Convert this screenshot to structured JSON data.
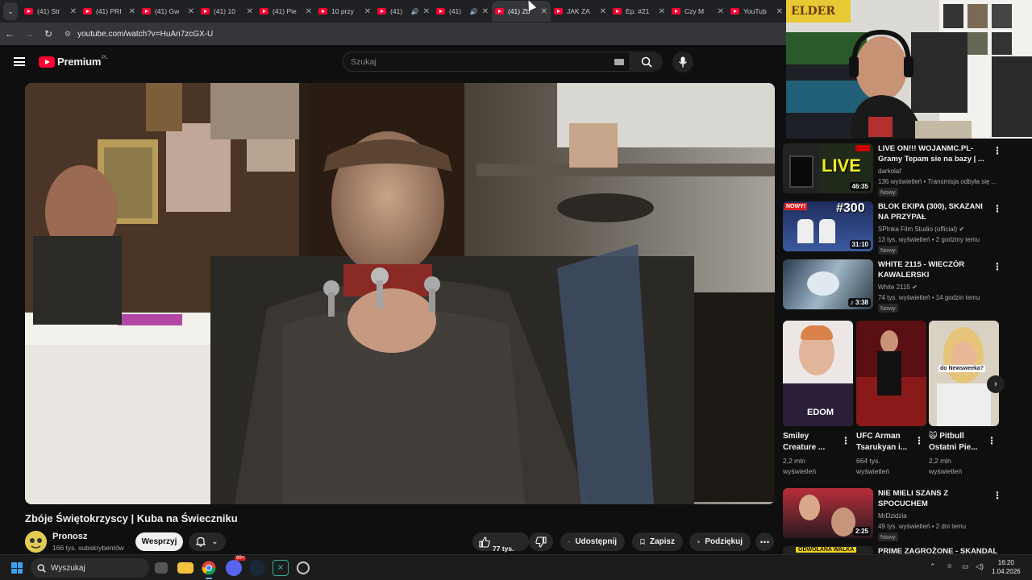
{
  "browser": {
    "tabs": [
      {
        "title": "(41) Str",
        "active": false,
        "audio": false
      },
      {
        "title": "(41) PRI",
        "active": false,
        "audio": false
      },
      {
        "title": "(41) Gw",
        "active": false,
        "audio": false
      },
      {
        "title": "(41) 10",
        "active": false,
        "audio": false
      },
      {
        "title": "(41) Pie",
        "active": false,
        "audio": false
      },
      {
        "title": "10 przy",
        "active": false,
        "audio": false
      },
      {
        "title": "(41)",
        "active": false,
        "audio": true
      },
      {
        "title": "(41)",
        "active": false,
        "audio": true
      },
      {
        "title": "(41) Zb",
        "active": true,
        "audio": false
      },
      {
        "title": "JAK ZA",
        "active": false,
        "audio": false
      },
      {
        "title": "Ep. #21",
        "active": false,
        "audio": false
      },
      {
        "title": "Czy M",
        "active": false,
        "audio": false
      },
      {
        "title": "YouTub",
        "active": false,
        "audio": false
      }
    ],
    "url": "youtube.com/watch?v=HuAn7zcGX-U"
  },
  "header": {
    "logo_text": "Premium",
    "country_code": "PL",
    "search_placeholder": "Szukaj"
  },
  "video": {
    "title": "Zbóje Świętokrzyscy | Kuba na Świeczniku",
    "channel_name": "Pronosz",
    "subscribers": "166 tys. subskrybentów",
    "support_label": "Wesprzyj",
    "like_count": "77 tys.",
    "share_label": "Udostępnij",
    "save_label": "Zapisz",
    "thanks_label": "Podziękuj"
  },
  "webcam": {
    "sign_text": "ELDER"
  },
  "sidebar": {
    "videos": [
      {
        "title": "LIVE ON!!! WOJANMC.PL- Gramy Tepam sie na bazy | ...",
        "channel": "darkolaf",
        "meta": "136 wyświetleń • Transmisja odbyła się ...",
        "duration": "46:35",
        "badge": "Nowy",
        "thumb_text": "LIVE"
      },
      {
        "title": "BLOK EKIPA (300), SKAZANI NA PRZYPAŁ",
        "channel": "SPInka Film Studio (official)",
        "meta": "13 tys. wyświetleń • 2 godziny temu",
        "duration": "31:10",
        "badge": "Nowy",
        "thumb_text": "#300",
        "thumb_tag": "NOWY!"
      },
      {
        "title": "WHITE 2115 - WIECZÓR KAWALERSKI",
        "channel": "White 2115",
        "meta": "74 tys. wyświetleń • 14 godzin temu",
        "duration": "♪ 3:38",
        "badge": "Nowy"
      }
    ],
    "shorts": [
      {
        "title": "Smiley Creature ...",
        "views": "2,2 mln",
        "views_unit": "wyświetleń",
        "overlay": "EDOM"
      },
      {
        "title": "UFC Arman Tsarukyan i...",
        "views": "664 tys.",
        "views_unit": "wyświetleń"
      },
      {
        "title": "🙀 Pitbull Ostatni Pie...",
        "views": "2,2 mln",
        "views_unit": "wyświetleń",
        "overlay": "do Newsweeka?"
      }
    ],
    "video4": {
      "title": "NIE MIELI SZANS Z SPOCUCHEM",
      "channel": "MrDzidzia",
      "meta": "49 tys. wyświetleń • 2 dni temu",
      "duration": "2:25",
      "badge": "Nowy"
    },
    "video5": {
      "title": "PRIME ZAGROŻONE - SKANDAL",
      "thumb_text": "ODWOŁANA WALKA"
    }
  },
  "taskbar": {
    "search_label": "Wyszukaj",
    "discord_badge": "99+",
    "time": "16:20",
    "date": "1.04.2026"
  },
  "colors": {
    "yt_red": "#ff0033",
    "background": "#0f0f0f",
    "pill": "#272727"
  }
}
